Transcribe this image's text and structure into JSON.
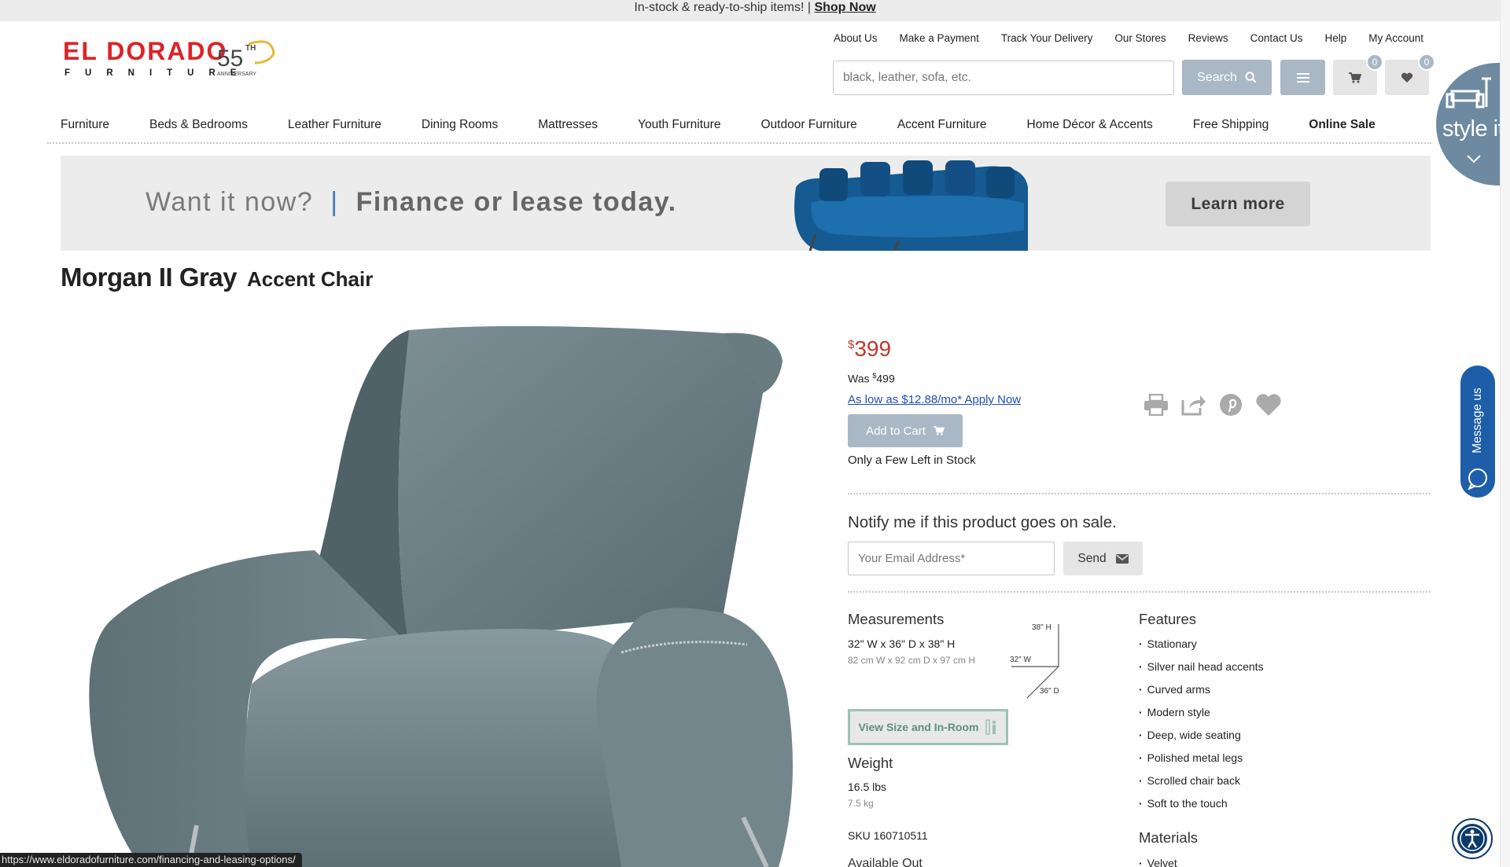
{
  "promo": {
    "text": "In-stock & ready-to-ship items! | ",
    "link": "Shop Now"
  },
  "logo": {
    "name": "EL DORADO",
    "sub": "FURNITURE",
    "anniv_num": "55",
    "anniv_sup": "TH",
    "anniv_label": "ANNIVERSARY"
  },
  "util_links": [
    "About Us",
    "Make a Payment",
    "Track Your Delivery",
    "Our Stores",
    "Reviews",
    "Contact Us",
    "Help",
    "My Account"
  ],
  "search": {
    "placeholder": "black, leather, sofa, etc.",
    "button": "Search"
  },
  "cart_count": "0",
  "wishlist_count": "0",
  "nav": [
    "Furniture",
    "Beds & Bedrooms",
    "Leather Furniture",
    "Dining Rooms",
    "Mattresses",
    "Youth Furniture",
    "Outdoor Furniture",
    "Accent Furniture",
    "Home Décor & Accents",
    "Free Shipping",
    "Online Sale"
  ],
  "style_it": "style it",
  "banner": {
    "part1": "Want it now?",
    "divider": "|",
    "part2": "Finance or lease today.",
    "cta": "Learn more"
  },
  "product": {
    "name": "Morgan II Gray",
    "type": "Accent Chair",
    "currency": "$",
    "price": "399",
    "was_label": "Was",
    "was_currency": "$",
    "was_price": "499",
    "finance": "As low as $12.88/mo* Apply Now",
    "add_to_cart": "Add to Cart",
    "stock": "Only a Few Left in Stock"
  },
  "notify": {
    "label": "Notify me if this product goes on sale.",
    "placeholder": "Your Email Address*",
    "send": "Send"
  },
  "measurements": {
    "heading": "Measurements",
    "imperial": "32\" W x 36\" D x 38\" H",
    "metric": "82 cm W x 92 cm D x 97 cm H",
    "h_label": "38\" H",
    "w_label": "32\" W",
    "d_label": "36\" D",
    "room_btn": "View Size and In-Room"
  },
  "weight": {
    "heading": "Weight",
    "lbs": "16.5 lbs",
    "kg": "7.5 kg"
  },
  "sku": "SKU 160710511",
  "availability_heading": "Available Out",
  "features": {
    "heading": "Features",
    "items": [
      "Stationary",
      "Silver nail head accents",
      "Curved arms",
      "Modern style",
      "Deep, wide seating",
      "Polished metal legs",
      "Scrolled chair back",
      "Soft to the touch"
    ]
  },
  "materials": {
    "heading": "Materials",
    "items": [
      "Velvet"
    ]
  },
  "message_us": "Message us",
  "status_url": "https://www.eldoradofurniture.com/financing-and-leasing-options/"
}
